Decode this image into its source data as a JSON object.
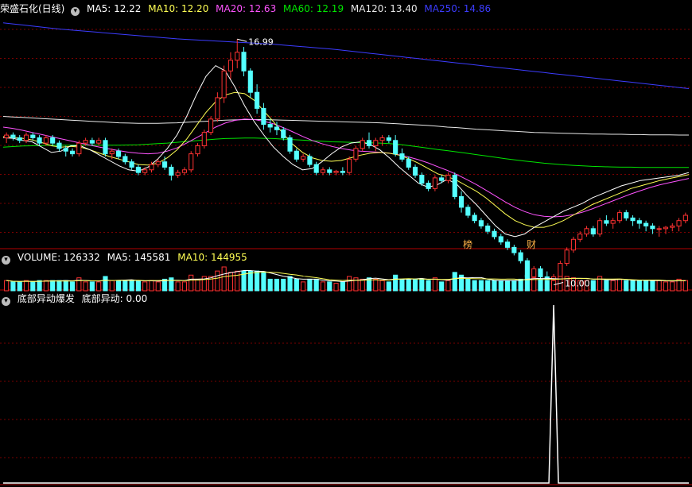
{
  "colors": {
    "up": "#ff3232",
    "down": "#54ffff",
    "grid": "#7a0000",
    "separator": "#b40000",
    "ma5": "#ffffff",
    "ma10": "#ffff54",
    "ma20": "#ff54ff",
    "ma60": "#00e600",
    "ma120": "#e8e8e8",
    "ma250": "#3c3cff",
    "signal": "#ffffff"
  },
  "price_panel": {
    "title": "荣盛石化(日线)",
    "icon": "chevron-down-icon",
    "legend": [
      {
        "label": "MA5: 12.22",
        "color": "#ffffff"
      },
      {
        "label": "MA10: 12.20",
        "color": "#ffff54"
      },
      {
        "label": "MA20: 12.63",
        "color": "#ff54ff"
      },
      {
        "label": "MA60: 12.19",
        "color": "#00e600"
      },
      {
        "label": "MA120: 13.40",
        "color": "#e8e8e8"
      },
      {
        "label": "MA250: 14.86",
        "color": "#3c3cff"
      }
    ],
    "high_label": "16.99",
    "low_label": "10.00",
    "markers": [
      "榜",
      "财"
    ]
  },
  "volume_panel": {
    "legend": [
      {
        "label": "VOLUME: 126332",
        "color": "#ffffff"
      },
      {
        "label": "MA5: 145581",
        "color": "#ffffff"
      },
      {
        "label": "MA10: 144955",
        "color": "#ffff54"
      }
    ]
  },
  "indicator_panel": {
    "legend": [
      {
        "label": "底部异动爆发",
        "color": "#ffffff"
      },
      {
        "label": "底部异动: 0.00",
        "color": "#ffffff"
      }
    ]
  },
  "chart_data": {
    "type": "candlestick",
    "price_range": [
      9.3,
      17.8
    ],
    "high": 16.99,
    "low": 10.0,
    "candles": [
      [
        13.3,
        13.5,
        13.1,
        13.4
      ],
      [
        13.4,
        13.5,
        13.2,
        13.3
      ],
      [
        13.3,
        13.4,
        13.1,
        13.2
      ],
      [
        13.2,
        13.5,
        13.1,
        13.4
      ],
      [
        13.4,
        13.5,
        13.2,
        13.3
      ],
      [
        13.3,
        13.4,
        13.0,
        13.1
      ],
      [
        13.1,
        13.4,
        13.0,
        13.3
      ],
      [
        13.3,
        13.4,
        13.0,
        13.1
      ],
      [
        13.1,
        13.2,
        12.8,
        12.9
      ],
      [
        12.9,
        13.0,
        12.6,
        12.8
      ],
      [
        12.8,
        12.9,
        12.6,
        12.7
      ],
      [
        12.7,
        13.2,
        12.6,
        13.1
      ],
      [
        13.1,
        13.3,
        13.0,
        13.2
      ],
      [
        13.2,
        13.3,
        13.0,
        13.1
      ],
      [
        13.1,
        13.3,
        13.0,
        13.2
      ],
      [
        13.2,
        13.3,
        12.6,
        12.7
      ],
      [
        12.7,
        12.9,
        12.5,
        12.8
      ],
      [
        12.8,
        12.9,
        12.5,
        12.6
      ],
      [
        12.6,
        12.7,
        12.3,
        12.4
      ],
      [
        12.4,
        12.5,
        12.1,
        12.2
      ],
      [
        12.2,
        12.3,
        11.9,
        12.0
      ],
      [
        12.0,
        12.2,
        11.9,
        12.1
      ],
      [
        12.1,
        12.4,
        12.0,
        12.3
      ],
      [
        12.3,
        12.5,
        12.2,
        12.4
      ],
      [
        12.4,
        12.6,
        12.1,
        12.2
      ],
      [
        12.2,
        12.3,
        11.7,
        11.9
      ],
      [
        11.9,
        12.1,
        11.8,
        12.0
      ],
      [
        12.0,
        12.2,
        11.9,
        12.1
      ],
      [
        12.1,
        12.8,
        12.0,
        12.7
      ],
      [
        12.7,
        13.1,
        12.6,
        13.0
      ],
      [
        13.0,
        13.6,
        12.9,
        13.5
      ],
      [
        13.5,
        14.1,
        13.4,
        14.0
      ],
      [
        14.0,
        15.0,
        13.9,
        14.8
      ],
      [
        14.8,
        16.0,
        14.6,
        15.8
      ],
      [
        15.8,
        16.5,
        15.5,
        16.2
      ],
      [
        16.2,
        16.99,
        15.9,
        16.5
      ],
      [
        16.5,
        16.7,
        15.6,
        15.8
      ],
      [
        15.8,
        15.9,
        14.8,
        15.0
      ],
      [
        15.0,
        15.3,
        14.2,
        14.4
      ],
      [
        14.4,
        14.6,
        13.6,
        13.8
      ],
      [
        13.8,
        14.0,
        13.5,
        13.7
      ],
      [
        13.7,
        13.9,
        13.4,
        13.6
      ],
      [
        13.6,
        13.7,
        13.2,
        13.3
      ],
      [
        13.3,
        13.4,
        12.7,
        12.8
      ],
      [
        12.8,
        12.9,
        12.4,
        12.5
      ],
      [
        12.5,
        12.7,
        12.4,
        12.6
      ],
      [
        12.6,
        12.7,
        12.2,
        12.3
      ],
      [
        12.3,
        12.4,
        11.9,
        12.0
      ],
      [
        12.0,
        12.2,
        11.9,
        12.1
      ],
      [
        12.1,
        12.2,
        11.9,
        12.0
      ],
      [
        12.0,
        12.1,
        11.9,
        12.05
      ],
      [
        12.05,
        12.2,
        11.9,
        12.0
      ],
      [
        12.0,
        12.6,
        11.9,
        12.5
      ],
      [
        12.5,
        13.0,
        12.4,
        12.9
      ],
      [
        12.9,
        13.3,
        12.8,
        13.2
      ],
      [
        13.2,
        13.5,
        12.9,
        13.0
      ],
      [
        13.0,
        13.3,
        12.8,
        13.2
      ],
      [
        13.2,
        13.4,
        13.0,
        13.3
      ],
      [
        13.3,
        13.4,
        13.1,
        13.2
      ],
      [
        13.2,
        13.4,
        12.6,
        12.7
      ],
      [
        12.7,
        12.9,
        12.4,
        12.5
      ],
      [
        12.5,
        12.6,
        12.1,
        12.2
      ],
      [
        12.2,
        12.3,
        11.8,
        11.9
      ],
      [
        11.9,
        12.0,
        11.5,
        11.6
      ],
      [
        11.6,
        11.7,
        11.3,
        11.4
      ],
      [
        11.4,
        11.9,
        11.3,
        11.8
      ],
      [
        11.8,
        11.9,
        11.6,
        11.7
      ],
      [
        11.7,
        12.0,
        11.6,
        11.9
      ],
      [
        11.9,
        12.0,
        11.0,
        11.1
      ],
      [
        11.1,
        11.3,
        10.5,
        10.7
      ],
      [
        10.7,
        10.8,
        10.3,
        10.4
      ],
      [
        10.4,
        10.5,
        10.1,
        10.2
      ],
      [
        10.2,
        10.3,
        9.9,
        10.0
      ],
      [
        10.0,
        10.1,
        9.7,
        9.8
      ],
      [
        9.8,
        9.9,
        9.5,
        9.6
      ],
      [
        9.6,
        9.7,
        9.3,
        9.4
      ],
      [
        9.4,
        9.5,
        9.1,
        9.2
      ],
      [
        9.2,
        9.3,
        8.9,
        9.0
      ],
      [
        9.0,
        9.1,
        8.6,
        8.7
      ],
      [
        8.7,
        8.8,
        8.0,
        8.1
      ],
      [
        8.1,
        8.5,
        7.9,
        8.4
      ],
      [
        8.4,
        8.5,
        8.0,
        8.1
      ],
      [
        8.1,
        8.3,
        7.9,
        8.0
      ],
      [
        8.0,
        8.2,
        7.8,
        8.1
      ],
      [
        8.1,
        8.7,
        8.0,
        8.6
      ],
      [
        8.6,
        9.2,
        8.5,
        9.1
      ],
      [
        9.1,
        9.6,
        9.0,
        9.5
      ],
      [
        9.5,
        9.8,
        9.4,
        9.7
      ],
      [
        9.7,
        10.0,
        9.6,
        9.9
      ],
      [
        9.9,
        10.0,
        9.6,
        9.7
      ],
      [
        9.7,
        10.3,
        9.6,
        10.2
      ],
      [
        10.2,
        10.4,
        10.0,
        10.1
      ],
      [
        10.1,
        10.3,
        9.9,
        10.2
      ],
      [
        10.2,
        10.6,
        10.1,
        10.5
      ],
      [
        10.5,
        10.6,
        10.2,
        10.3
      ],
      [
        10.3,
        10.4,
        10.0,
        10.2
      ],
      [
        10.2,
        10.3,
        9.9,
        10.1
      ],
      [
        10.1,
        10.2,
        9.8,
        10.0
      ],
      [
        10.0,
        10.1,
        9.7,
        9.9
      ],
      [
        9.9,
        10.0,
        9.6,
        9.9
      ],
      [
        9.9,
        10.0,
        9.7,
        9.95
      ],
      [
        9.95,
        10.1,
        9.8,
        10.0
      ],
      [
        10.0,
        10.3,
        9.8,
        10.2
      ],
      [
        10.2,
        10.5,
        10.1,
        10.4
      ]
    ],
    "ma5": [
      13.3,
      13.28,
      13.2,
      13.15,
      12.95,
      12.75,
      12.8,
      13.0,
      13.0,
      12.85,
      12.65,
      12.45,
      12.25,
      12.1,
      12.05,
      12.2,
      12.5,
      12.9,
      13.4,
      14.1,
      14.9,
      15.6,
      16.0,
      15.8,
      15.2,
      14.5,
      13.9,
      13.4,
      12.95,
      12.6,
      12.3,
      12.1,
      12.15,
      12.4,
      12.7,
      12.95,
      13.1,
      13.15,
      13.05,
      12.85,
      12.55,
      12.2,
      11.9,
      11.6,
      11.45,
      11.55,
      11.75,
      11.55,
      11.15,
      10.8,
      10.4,
      10.0,
      9.7,
      9.6,
      9.7,
      9.95,
      10.15,
      10.35,
      10.55,
      10.7,
      10.85,
      11.05,
      11.2,
      11.35,
      11.5,
      11.6,
      11.7,
      11.75,
      11.8,
      11.85,
      11.9,
      12.0
    ],
    "ma10": [
      13.35,
      13.32,
      13.28,
      13.22,
      13.12,
      13.0,
      12.95,
      12.98,
      12.95,
      12.85,
      12.72,
      12.6,
      12.5,
      12.4,
      12.3,
      12.28,
      12.35,
      12.55,
      12.85,
      13.25,
      13.75,
      14.25,
      14.65,
      14.9,
      15.0,
      14.95,
      14.7,
      14.3,
      13.9,
      13.45,
      13.05,
      12.75,
      12.55,
      12.45,
      12.42,
      12.45,
      12.55,
      12.65,
      12.72,
      12.75,
      12.72,
      12.65,
      12.52,
      12.35,
      12.15,
      11.95,
      11.85,
      11.7,
      11.5,
      11.3,
      11.05,
      10.75,
      10.45,
      10.2,
      10.05,
      9.95,
      9.95,
      10.05,
      10.2,
      10.4,
      10.6,
      10.8,
      10.95,
      11.1,
      11.25,
      11.4,
      11.5,
      11.6,
      11.7,
      11.78,
      11.85,
      11.92
    ],
    "ma20": [
      13.7,
      13.65,
      13.58,
      13.5,
      13.42,
      13.34,
      13.26,
      13.18,
      13.1,
      13.02,
      12.95,
      12.88,
      12.82,
      12.76,
      12.72,
      12.7,
      12.72,
      12.8,
      12.92,
      13.1,
      13.3,
      13.5,
      13.7,
      13.85,
      13.95,
      14.0,
      13.98,
      13.92,
      13.82,
      13.68,
      13.52,
      13.35,
      13.2,
      13.08,
      12.98,
      12.9,
      12.84,
      12.8,
      12.78,
      12.76,
      12.72,
      12.66,
      12.58,
      12.48,
      12.36,
      12.22,
      12.08,
      11.92,
      11.74,
      11.55,
      11.34,
      11.12,
      10.9,
      10.7,
      10.54,
      10.42,
      10.36,
      10.34,
      10.36,
      10.42,
      10.52,
      10.64,
      10.78,
      10.92,
      11.06,
      11.2,
      11.32,
      11.44,
      11.54,
      11.62,
      11.7,
      11.78
    ],
    "ma60": [
      12.95,
      12.97,
      12.99,
      13.0,
      13.01,
      13.02,
      13.02,
      13.02,
      13.02,
      13.02,
      13.02,
      13.02,
      13.02,
      13.03,
      13.04,
      13.06,
      13.08,
      13.1,
      13.13,
      13.16,
      13.19,
      13.22,
      13.25,
      13.27,
      13.28,
      13.29,
      13.29,
      13.28,
      13.27,
      13.25,
      13.23,
      13.21,
      13.19,
      13.17,
      13.15,
      13.14,
      13.13,
      13.12,
      13.11,
      13.1,
      13.08,
      13.05,
      13.01,
      12.96,
      12.91,
      12.86,
      12.82,
      12.77,
      12.72,
      12.67,
      12.62,
      12.57,
      12.52,
      12.47,
      12.43,
      12.39,
      12.35,
      12.32,
      12.29,
      12.27,
      12.25,
      12.23,
      12.22,
      12.21,
      12.2,
      12.2,
      12.19,
      12.19,
      12.19,
      12.19,
      12.19,
      12.19
    ],
    "ma120": [
      14.1,
      14.08,
      14.06,
      14.04,
      14.02,
      14.0,
      13.98,
      13.96,
      13.94,
      13.92,
      13.9,
      13.88,
      13.86,
      13.85,
      13.84,
      13.84,
      13.84,
      13.85,
      13.86,
      13.88,
      13.9,
      13.92,
      13.94,
      13.96,
      13.97,
      13.98,
      13.98,
      13.98,
      13.97,
      13.96,
      13.95,
      13.94,
      13.93,
      13.92,
      13.91,
      13.9,
      13.89,
      13.88,
      13.87,
      13.86,
      13.84,
      13.82,
      13.8,
      13.78,
      13.76,
      13.73,
      13.7,
      13.68,
      13.65,
      13.62,
      13.6,
      13.58,
      13.56,
      13.54,
      13.52,
      13.5,
      13.49,
      13.48,
      13.47,
      13.46,
      13.45,
      13.44,
      13.44,
      13.43,
      13.43,
      13.42,
      13.42,
      13.41,
      13.41,
      13.41,
      13.4,
      13.4
    ],
    "ma250": [
      17.6,
      17.56,
      17.52,
      17.48,
      17.44,
      17.4,
      17.36,
      17.33,
      17.3,
      17.27,
      17.24,
      17.21,
      17.18,
      17.15,
      17.12,
      17.09,
      17.06,
      17.03,
      17.0,
      16.98,
      16.96,
      16.94,
      16.92,
      16.9,
      16.88,
      16.86,
      16.84,
      16.82,
      16.8,
      16.77,
      16.74,
      16.71,
      16.68,
      16.65,
      16.62,
      16.58,
      16.54,
      16.5,
      16.46,
      16.42,
      16.38,
      16.34,
      16.3,
      16.26,
      16.22,
      16.18,
      16.14,
      16.1,
      16.06,
      16.02,
      15.98,
      15.94,
      15.9,
      15.86,
      15.82,
      15.78,
      15.74,
      15.7,
      15.66,
      15.62,
      15.58,
      15.54,
      15.5,
      15.46,
      15.42,
      15.38,
      15.34,
      15.3,
      15.26,
      15.22,
      15.18,
      15.14
    ]
  }
}
